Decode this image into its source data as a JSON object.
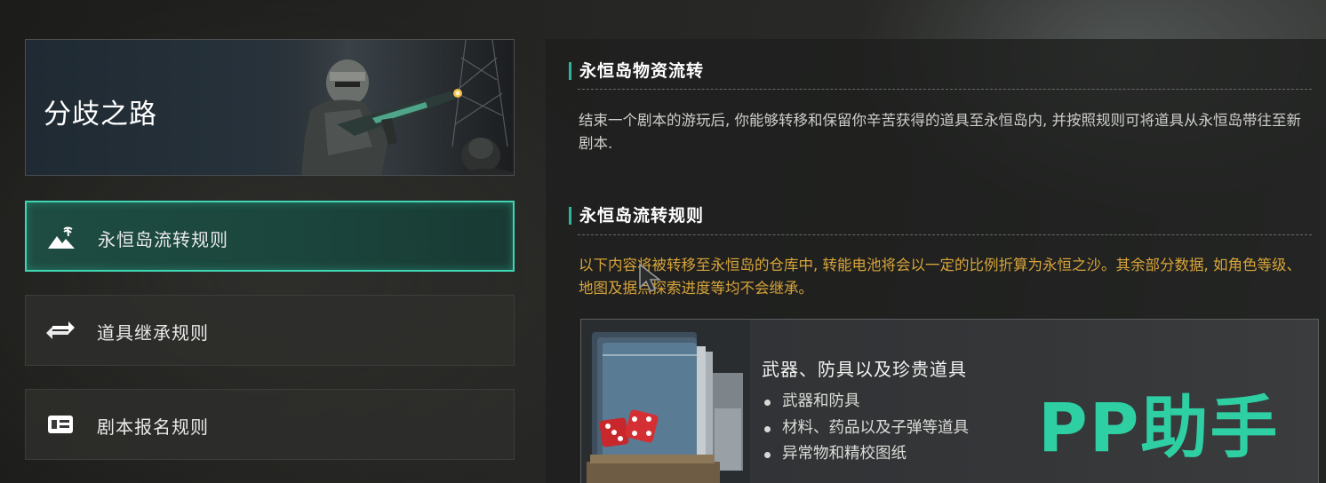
{
  "banner": {
    "title": "分歧之路"
  },
  "nav": {
    "items": [
      {
        "label": "永恒岛流转规则",
        "icon": "island-icon",
        "active": true
      },
      {
        "label": "道具继承规则",
        "icon": "swap-arrows-icon",
        "active": false
      },
      {
        "label": "剧本报名规则",
        "icon": "id-card-icon",
        "active": false
      }
    ]
  },
  "sections": [
    {
      "title": "永恒岛物资流转",
      "body": "结束一个剧本的游玩后, 你能够转移和保留你辛苦获得的道具至永恒岛内, 并按照规则可将道具从永恒岛带往至新剧本."
    },
    {
      "title": "永恒岛流转规则",
      "body": "以下内容将被转移至永恒岛的仓库中, 转能电池将会以一定的比例折算为永恒之沙。其余部分数据, 如角色等级、地图及据点探索进度等均不会继承。"
    }
  ],
  "card": {
    "title": "武器、防具以及珍贵道具",
    "bullets": [
      "武器和防具",
      "材料、药品以及子弹等道具",
      "异常物和精校图纸"
    ]
  },
  "watermark": "PP助手",
  "colors": {
    "accent": "#3fd6b3",
    "warning": "#d8a43a",
    "watermark": "#2fcfa4"
  }
}
